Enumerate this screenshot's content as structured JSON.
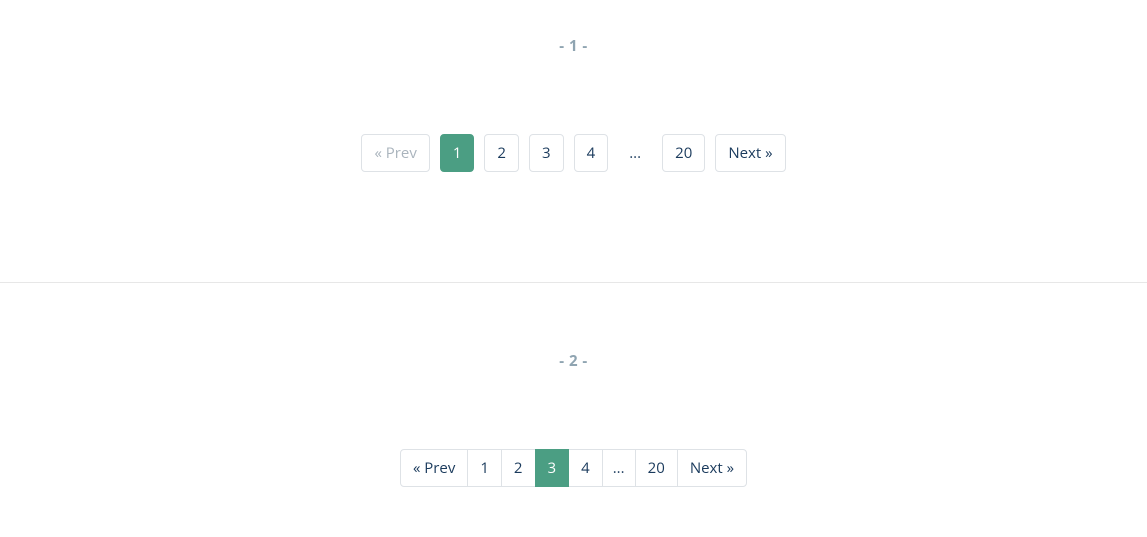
{
  "sections": {
    "one": {
      "title": "- 1 -",
      "prev_label": "« Prev",
      "next_label": "Next »",
      "ellipsis": "...",
      "pages": {
        "p1": "1",
        "p2": "2",
        "p3": "3",
        "p4": "4",
        "last": "20"
      },
      "active_page": "1"
    },
    "two": {
      "title": "- 2 -",
      "prev_label": "« Prev",
      "next_label": "Next »",
      "ellipsis": "...",
      "pages": {
        "p1": "1",
        "p2": "2",
        "p3": "3",
        "p4": "4",
        "last": "20"
      },
      "active_page": "3"
    }
  }
}
